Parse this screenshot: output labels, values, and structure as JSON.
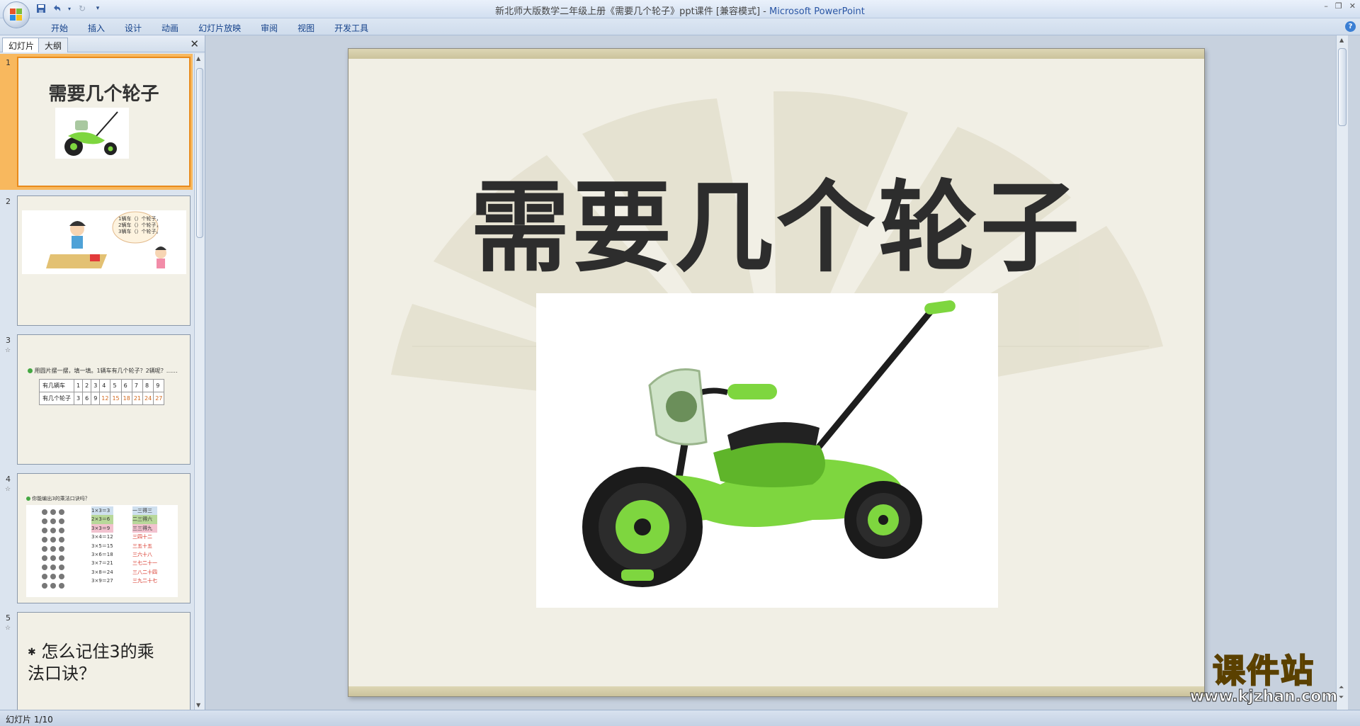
{
  "window": {
    "title": "新北师大版数学二年级上册《需要几个轮子》ppt课件 [兼容模式] - ",
    "app_name": "Microsoft PowerPoint",
    "controls": [
      "–",
      "❐",
      "✕"
    ]
  },
  "ribbon": {
    "tabs": [
      "开始",
      "插入",
      "设计",
      "动画",
      "幻灯片放映",
      "审阅",
      "视图",
      "开发工具"
    ]
  },
  "pane": {
    "tabs": [
      "幻灯片",
      "大纲"
    ],
    "slides": [
      {
        "number": "1",
        "title": "需要几个轮子"
      },
      {
        "number": "2",
        "bubble": [
          "1辆车（）个轮子，",
          "2辆车（）个轮子，",
          "3辆车（）个轮子。"
        ]
      },
      {
        "number": "3",
        "anim": "☆",
        "instruction": "用圆片摆一摆，填一填。1辆车有几个轮子？2辆呢？……",
        "table": {
          "header_row1": "有几辆车",
          "header_row2": "有几个轮子",
          "cars": [
            "1",
            "2",
            "3",
            "4",
            "5",
            "6",
            "7",
            "8",
            "9"
          ],
          "wheels": [
            "3",
            "6",
            "9",
            "12",
            "15",
            "18",
            "21",
            "24",
            "27"
          ]
        }
      },
      {
        "number": "4",
        "anim": "☆",
        "instruction": "你能编出3的乘法口诀吗？",
        "facts": [
          "1×3＝3",
          "2×3＝6",
          "3×3＝9",
          "3×4＝12",
          "3×5＝15",
          "3×6＝18",
          "3×7＝21",
          "3×8＝24",
          "3×9＝27"
        ],
        "rhymes": [
          "一三得三",
          "二三得六",
          "三三得九",
          "三四十二",
          "三五十五",
          "三六十八",
          "三七二十一",
          "三八二十四",
          "三九二十七"
        ]
      },
      {
        "number": "5",
        "anim": "☆",
        "bullet": "✱",
        "text": "怎么记住3的乘法口诀？"
      }
    ]
  },
  "slide": {
    "title": "需要几个轮子"
  },
  "status": {
    "text": "幻灯片 1/10"
  },
  "watermark": {
    "brand": "课件站",
    "url": "www.kjzhan.com"
  },
  "colors": {
    "trike_green": "#7ed63f",
    "title_text": "#2d2d2d",
    "active_thumb": "#f8b85e",
    "app_name_blue": "#2a56a5"
  }
}
